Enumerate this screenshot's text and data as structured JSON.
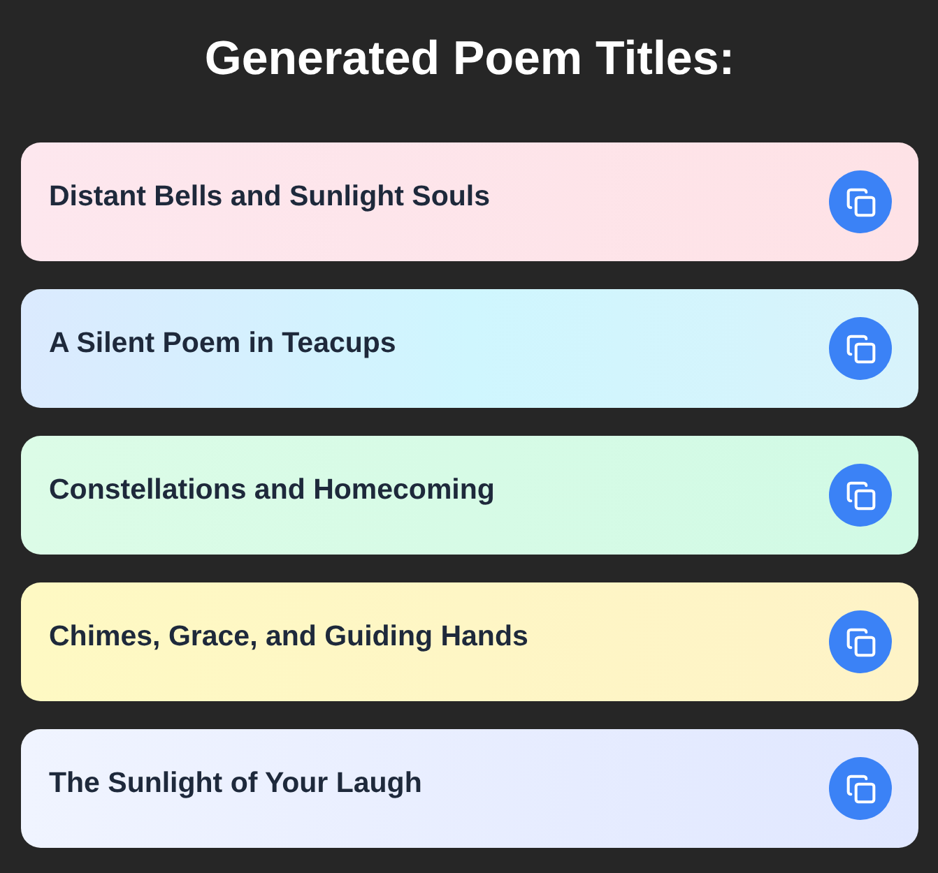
{
  "heading": "Generated Poem Titles:",
  "titles": [
    "Distant Bells and Sunlight Souls",
    "A Silent Poem in Teacups",
    "Constellations and Homecoming",
    "Chimes, Grace, and Guiding Hands",
    "The Sunlight of Your Laugh"
  ]
}
